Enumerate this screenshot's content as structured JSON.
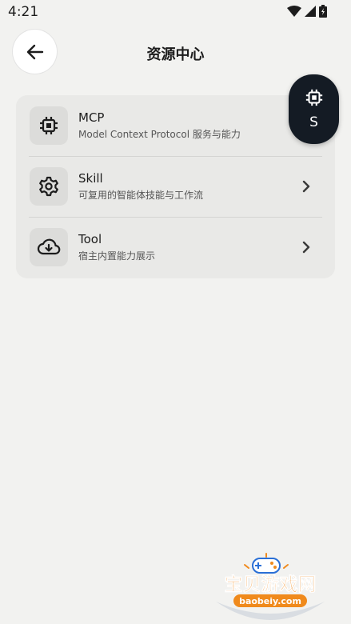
{
  "status_bar": {
    "time": "4:21"
  },
  "header": {
    "title": "资源中心"
  },
  "resources": [
    {
      "icon": "chip-icon",
      "title": "MCP",
      "subtitle": "Model Context Protocol 服务与能力"
    },
    {
      "icon": "gear-icon",
      "title": "Skill",
      "subtitle": "可复用的智能体技能与工作流"
    },
    {
      "icon": "cloud-download-icon",
      "title": "Tool",
      "subtitle": "宿主内置能力展示"
    }
  ],
  "fab": {
    "icon": "chip-icon",
    "label": "S"
  },
  "watermark": {
    "name": "宝贝游戏网",
    "url": "baobeiy.com"
  },
  "colors": {
    "background": "#f2f2f0",
    "card": "#e9e9e7",
    "fab": "#141b24",
    "watermark_blue": "#2a6fd6",
    "watermark_orange": "#f08a1c"
  }
}
